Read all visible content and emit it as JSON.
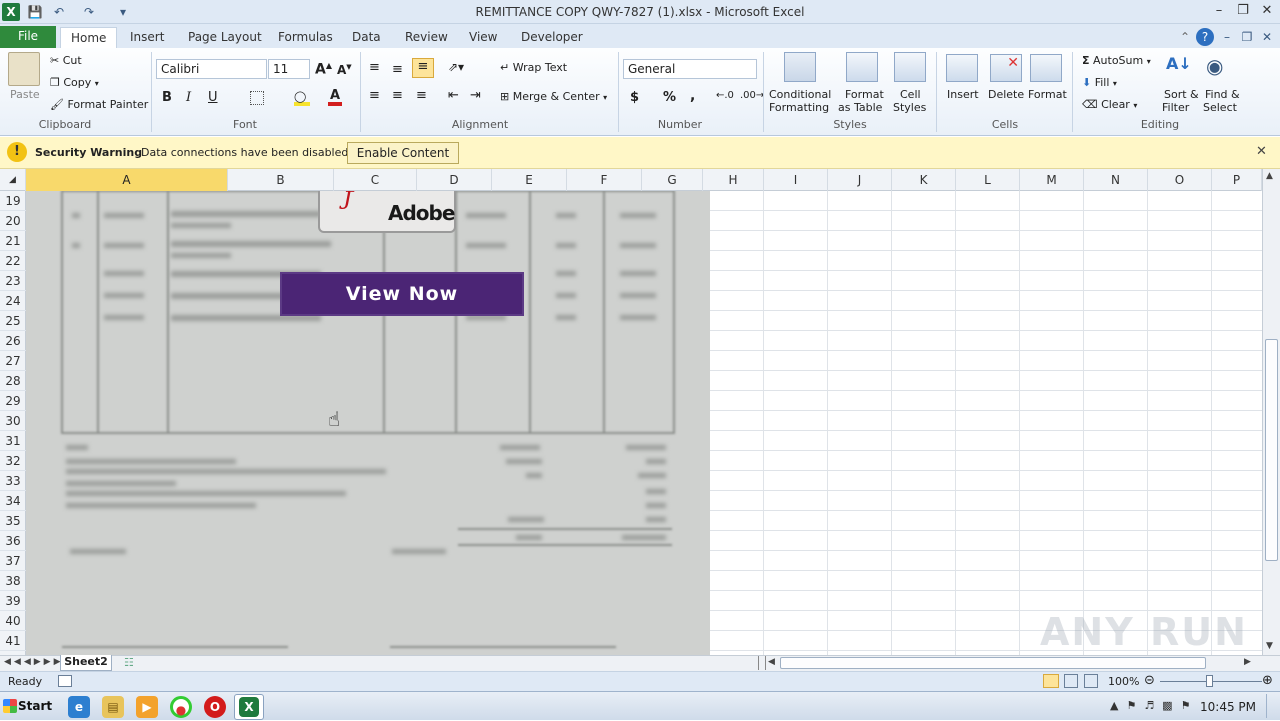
{
  "window": {
    "title": "REMITTANCE COPY QWY-7827 (1).xlsx  -  Microsoft Excel"
  },
  "tabs": [
    "File",
    "Home",
    "Insert",
    "Page Layout",
    "Formulas",
    "Data",
    "Review",
    "View",
    "Developer"
  ],
  "ribbon": {
    "clipboard": {
      "paste": "Paste",
      "cut": "Cut",
      "copy": "Copy",
      "format_painter": "Format Painter",
      "label": "Clipboard"
    },
    "font": {
      "name": "Calibri",
      "size": "11",
      "label": "Font",
      "bold": "B",
      "italic": "I",
      "underline": "U"
    },
    "alignment": {
      "wrap_text": "Wrap Text",
      "merge_center": "Merge & Center",
      "label": "Alignment"
    },
    "number": {
      "format": "General",
      "label": "Number",
      "currency": "$",
      "percent": "%",
      "comma": ","
    },
    "styles": {
      "conditional": "Conditional",
      "conditional2": "Formatting",
      "format_table": "Format",
      "format_table2": "as Table",
      "cell_styles": "Cell",
      "cell_styles2": "Styles",
      "label": "Styles"
    },
    "cells": {
      "insert": "Insert",
      "delete": "Delete",
      "format": "Format",
      "label": "Cells"
    },
    "editing": {
      "autosum": "AutoSum",
      "fill": "Fill",
      "clear": "Clear",
      "sort": "Sort &",
      "sort2": "Filter",
      "find": "Find &",
      "find2": "Select",
      "label": "Editing"
    }
  },
  "security_bar": {
    "title": "Security Warning",
    "message": "Data connections have been disabled",
    "button": "Enable Content"
  },
  "columns": [
    "A",
    "B",
    "C",
    "D",
    "E",
    "F",
    "G",
    "H",
    "I",
    "J",
    "K",
    "L",
    "M",
    "N",
    "O",
    "P"
  ],
  "rows": [
    "19",
    "20",
    "21",
    "22",
    "23",
    "24",
    "25",
    "26",
    "27",
    "28",
    "29",
    "30",
    "31",
    "32",
    "33",
    "34",
    "35",
    "36",
    "37",
    "38",
    "39",
    "40",
    "41"
  ],
  "document": {
    "adobe_text": "Adobe",
    "view_now": "View Now"
  },
  "sheet_tab": "Sheet2",
  "status": {
    "ready": "Ready",
    "zoom": "100%"
  },
  "taskbar": {
    "start": "Start",
    "time": "10:45 PM"
  },
  "watermark": "ANY RUN"
}
